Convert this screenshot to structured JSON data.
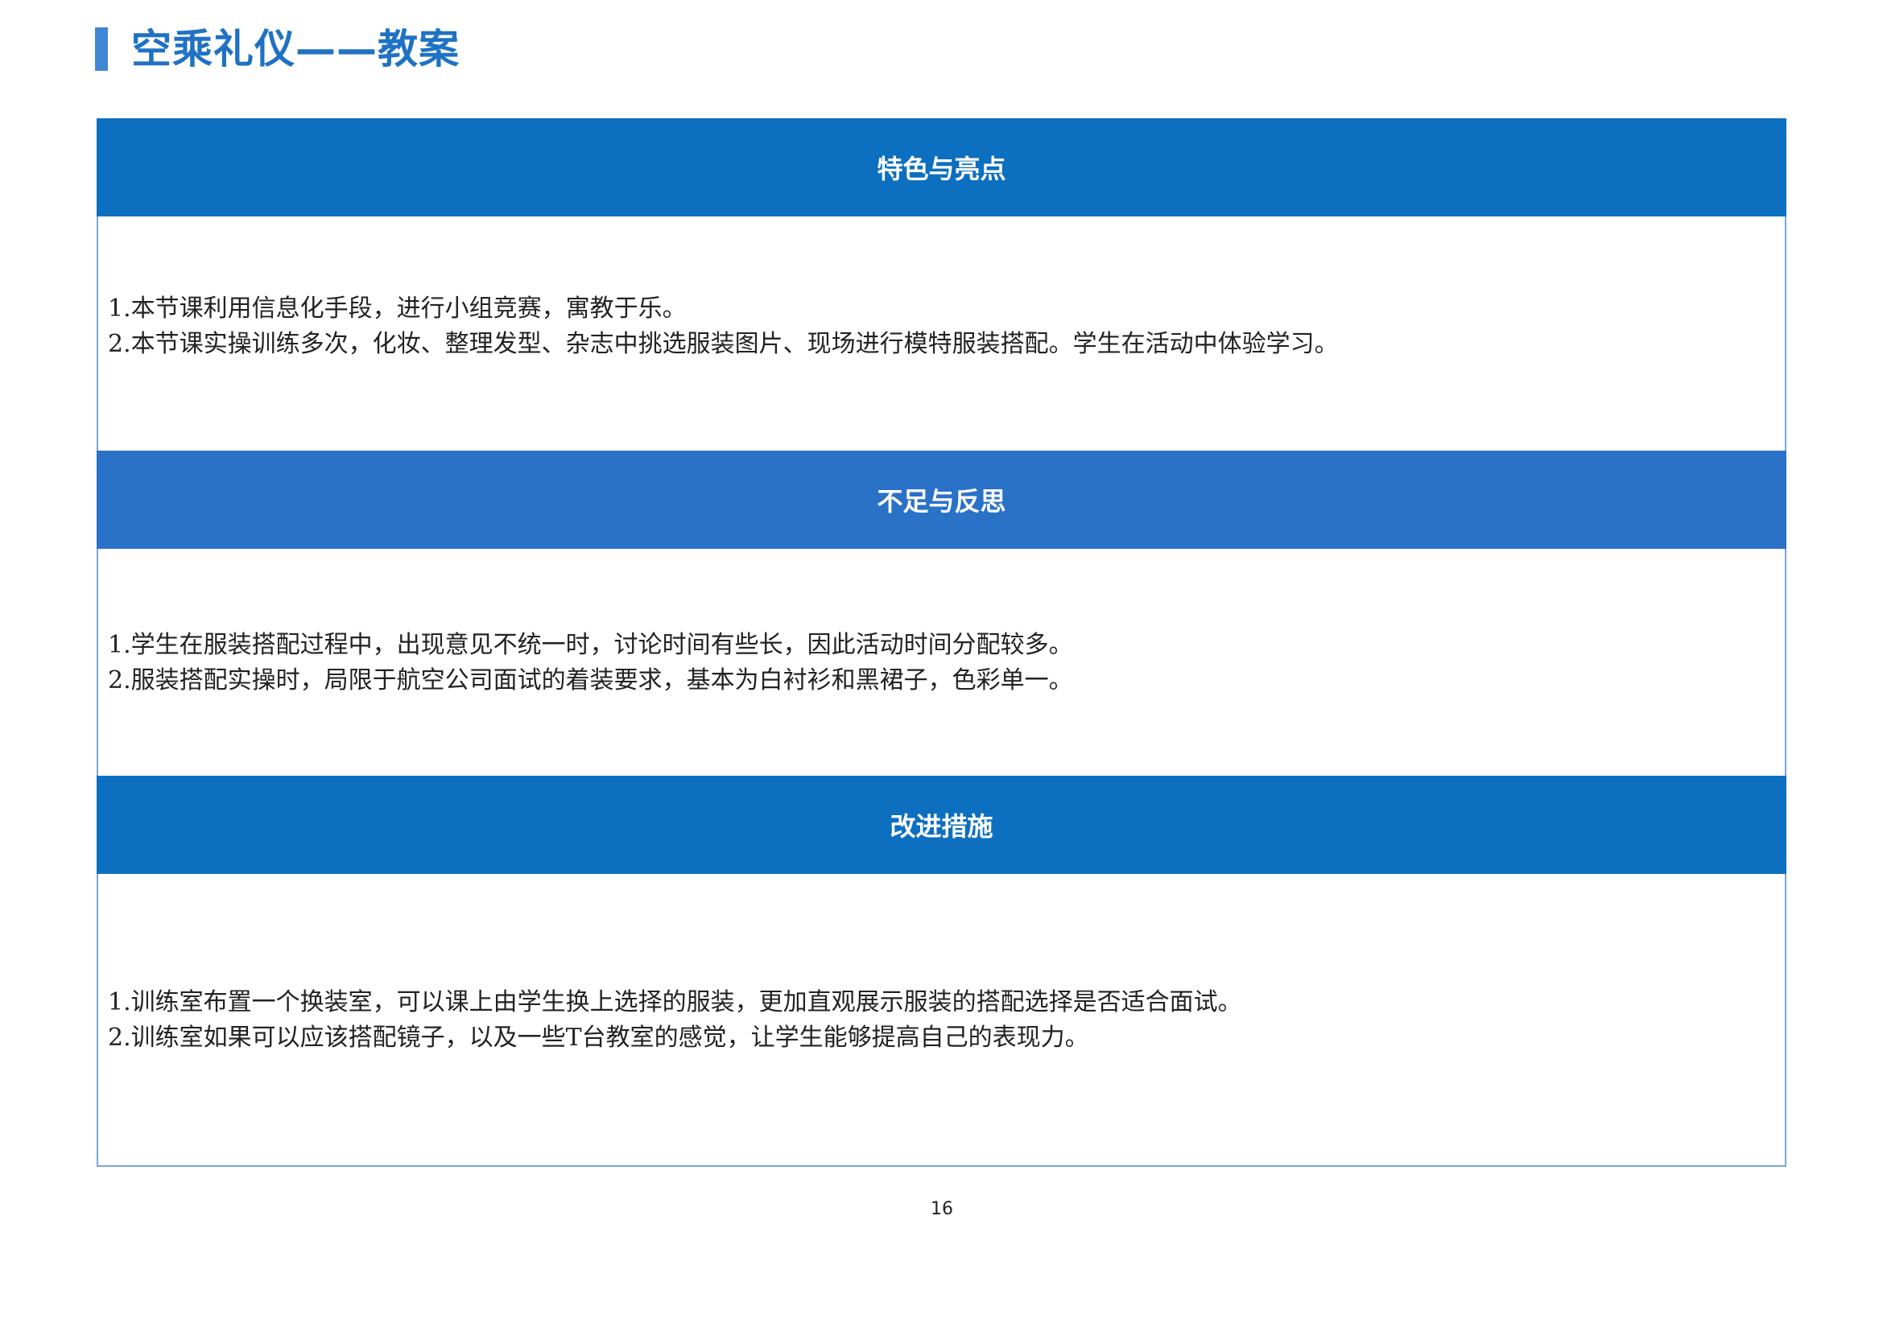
{
  "document": {
    "title": "空乘礼仪——教案",
    "page_number": "16"
  },
  "sections": [
    {
      "heading": "特色与亮点",
      "lines": [
        "1.本节课利用信息化手段，进行小组竞赛，寓教于乐。",
        "2.本节课实操训练多次，化妆、整理发型、杂志中挑选服装图片、现场进行模特服装搭配。学生在活动中体验学习。"
      ]
    },
    {
      "heading": "不足与反思",
      "lines": [
        "1.学生在服装搭配过程中，出现意见不统一时，讨论时间有些长，因此活动时间分配较多。",
        "2.服装搭配实操时，局限于航空公司面试的着装要求，基本为白衬衫和黑裙子，色彩单一。"
      ]
    },
    {
      "heading": "改进措施",
      "lines": [
        "1.训练室布置一个换装室，可以课上由学生换上选择的服装，更加直观展示服装的搭配选择是否适合面试。",
        "2.训练室如果可以应该搭配镜子，以及一些T台教室的感觉，让学生能够提高自己的表现力。"
      ]
    }
  ],
  "colors": {
    "title": "#1f72c3",
    "title_bar": "#3f86d4",
    "band_primary": "#0d6fbf",
    "band_secondary": "#2a71c8",
    "frame_border": "#7aa6d8"
  }
}
